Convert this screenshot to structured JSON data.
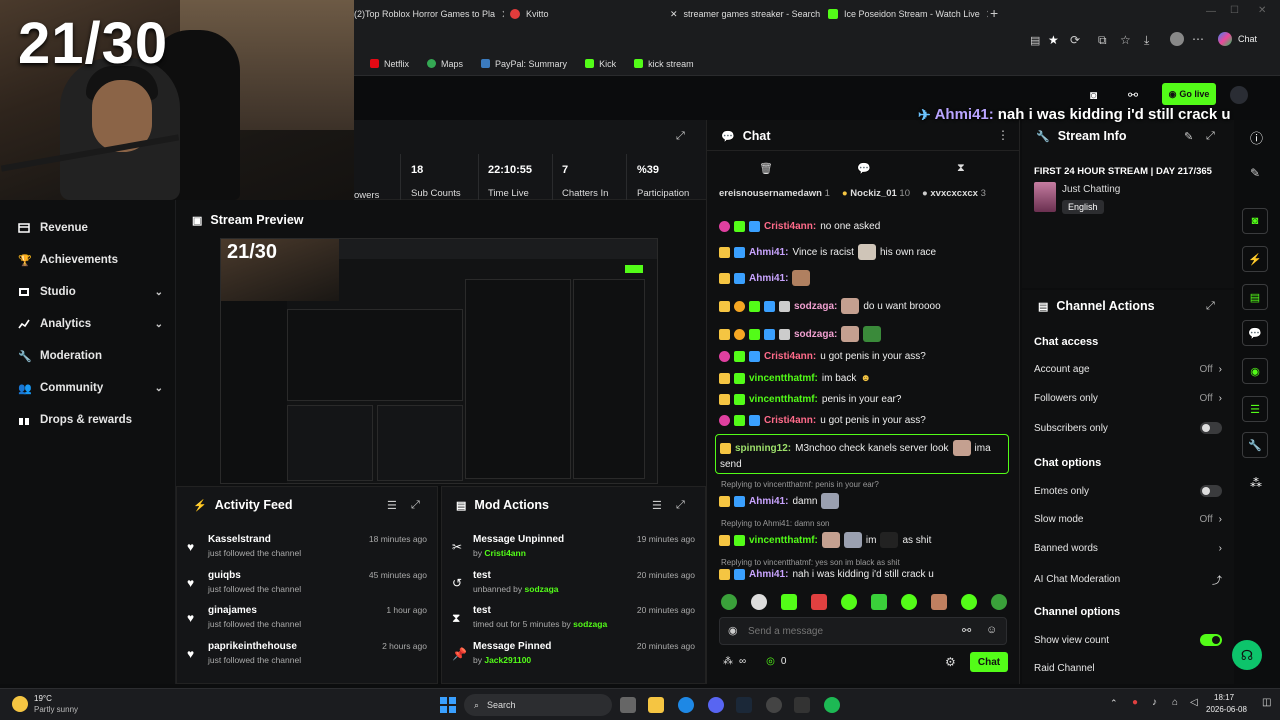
{
  "stream_counter": "21/30",
  "browser": {
    "tabs": [
      {
        "label": "(2)Top Roblox Horror Games to Pla",
        "color": "#ff2020"
      },
      {
        "label": "Kvitto",
        "color": "#e23c3c"
      },
      {
        "label": "streamer games streaker - Search",
        "color": "#ffffff"
      },
      {
        "label": "Ice Poseidon Stream - Watch Live",
        "color": "#53fc18"
      }
    ],
    "chat_button": "Chat",
    "bookmarks": [
      {
        "label": "Netflix",
        "color": "#e50914"
      },
      {
        "label": "Maps",
        "color": "#34a853"
      },
      {
        "label": "PayPal: Summary",
        "color": "#3b7bbf"
      },
      {
        "label": "Kick",
        "color": "#53fc18"
      },
      {
        "label": "kick stream",
        "color": "#53fc18"
      }
    ]
  },
  "header": {
    "go_live": "Go live"
  },
  "overlay_message": {
    "user": "Ahmi41:",
    "text": "nah i was kidding i'd still crack u"
  },
  "sidebar": {
    "items": [
      {
        "label": "Revenue",
        "icon": "revenue-icon",
        "chevron": false
      },
      {
        "label": "Achievements",
        "icon": "trophy-icon",
        "chevron": false
      },
      {
        "label": "Studio",
        "icon": "studio-icon",
        "chevron": true
      },
      {
        "label": "Analytics",
        "icon": "analytics-icon",
        "chevron": true
      },
      {
        "label": "Moderation",
        "icon": "wrench-icon",
        "chevron": false
      },
      {
        "label": "Community",
        "icon": "community-icon",
        "chevron": true
      },
      {
        "label": "Drops & rewards",
        "icon": "gift-icon",
        "chevron": false
      }
    ]
  },
  "stats": {
    "followers_label": "owers",
    "sub_counts": {
      "value": "18",
      "label": "Sub Counts"
    },
    "time_live": {
      "value": "22:10:55",
      "label": "Time Live"
    },
    "chatters_in": {
      "value": "7",
      "label": "Chatters In"
    },
    "participation": {
      "value": "%39",
      "label": "Participation"
    }
  },
  "preview": {
    "title": "Stream Preview",
    "counter": "21/30"
  },
  "activity_feed": {
    "title": "Activity Feed",
    "items": [
      {
        "name": "Kasselstrand",
        "sub": "just followed the channel",
        "time": "18 minutes ago"
      },
      {
        "name": "guiqbs",
        "sub": "just followed the channel",
        "time": "45 minutes ago"
      },
      {
        "name": "ginajames",
        "sub": "just followed the channel",
        "time": "1 hour ago"
      },
      {
        "name": "paprikeinthehouse",
        "sub": "just followed the channel",
        "time": "2 hours ago"
      }
    ]
  },
  "mod_actions": {
    "title": "Mod Actions",
    "items": [
      {
        "name": "Message Unpinned",
        "sub_prefix": "by ",
        "sub_user": "Cristi4ann",
        "sub_suffix": "",
        "time": "19 minutes ago"
      },
      {
        "name": "test",
        "sub_prefix": "unbanned by ",
        "sub_user": "sodzaga",
        "sub_suffix": "",
        "time": "20 minutes ago"
      },
      {
        "name": "test",
        "sub_prefix": "timed out for 5 minutes by ",
        "sub_user": "sodzaga",
        "sub_suffix": "",
        "time": "20 minutes ago"
      },
      {
        "name": "Message Pinned",
        "sub_prefix": "by ",
        "sub_user": "Jack291100",
        "sub_suffix": "",
        "time": "20 minutes ago"
      }
    ]
  },
  "chat": {
    "title": "Chat",
    "leaderboard": [
      {
        "name": "ereisnousernamedawn",
        "count": "1"
      },
      {
        "name": "Nockiz_01",
        "count": "10"
      },
      {
        "name": "xvxcxcxcx",
        "count": "3"
      }
    ],
    "messages": [
      {
        "user": "Cristi4ann:",
        "cls": "u3",
        "text": "no one asked",
        "emote": false
      },
      {
        "user": "Ahmi41:",
        "cls": "u1",
        "text": "Vince is racist",
        "text2": "his own race",
        "emote": true
      },
      {
        "user": "Ahmi41:",
        "cls": "u1",
        "text": "",
        "emote": true
      },
      {
        "user": "sodzaga:",
        "cls": "u5",
        "text": "do u want broooo",
        "emote": true
      },
      {
        "user": "sodzaga:",
        "cls": "u5",
        "text": "",
        "emote": true
      },
      {
        "user": "Cristi4ann:",
        "cls": "u3",
        "text": "u got penis in your ass?",
        "emote": false
      },
      {
        "user": "vincentthatmf:",
        "cls": "u2",
        "text": "im back",
        "emote": false
      },
      {
        "user": "vincentthatmf:",
        "cls": "u2",
        "text": "penis in your ear?",
        "emote": false
      },
      {
        "user": "Cristi4ann:",
        "cls": "u3",
        "text": "u got penis in your ass?",
        "emote": false
      }
    ],
    "highlight": {
      "user": "spinning12:",
      "text": "M3nchoo check kanels server look",
      "text2": "ima",
      "text3": "send"
    },
    "replies": [
      {
        "reply": "Replying to vincentthatmf: penis in your ear?",
        "user": "Ahmi41:",
        "cls": "u1",
        "text": "damn"
      },
      {
        "reply": "Replying to Ahmi41: damn son",
        "user": "vincentthatmf:",
        "cls": "u2",
        "text": "im",
        "text2": "as shit"
      },
      {
        "reply": "Replying to vincentthatmf: yes son im black as shit",
        "user": "Ahmi41:",
        "cls": "u1",
        "text": "nah i was kidding i'd still crack u"
      }
    ],
    "input_placeholder": "Send a message",
    "infinity": "∞",
    "zero": "0",
    "send_label": "Chat"
  },
  "stream_info": {
    "title": "Stream Info",
    "stream_title": "FIRST 24 HOUR STREAM | DAY 217/365",
    "category": "Just Chatting",
    "language": "English"
  },
  "channel_actions": {
    "title": "Channel Actions",
    "chat_access": "Chat access",
    "account_age": {
      "label": "Account age",
      "value": "Off"
    },
    "followers_only": {
      "label": "Followers only",
      "value": "Off"
    },
    "subscribers_only": "Subscribers only",
    "chat_options": "Chat options",
    "emotes_only": "Emotes only",
    "slow_mode": {
      "label": "Slow mode",
      "value": "Off"
    },
    "banned_words": "Banned words",
    "ai_moderation": "AI Chat Moderation",
    "channel_options": "Channel options",
    "show_view_count": "Show view count",
    "raid_channel": "Raid Channel"
  },
  "taskbar": {
    "temperature": "19°C",
    "weather": "Partly sunny",
    "search": "Search",
    "time": "18:17",
    "date": "2026-06-08"
  },
  "colors": {
    "accent": "#53fc18",
    "bg": "#0f1011"
  }
}
